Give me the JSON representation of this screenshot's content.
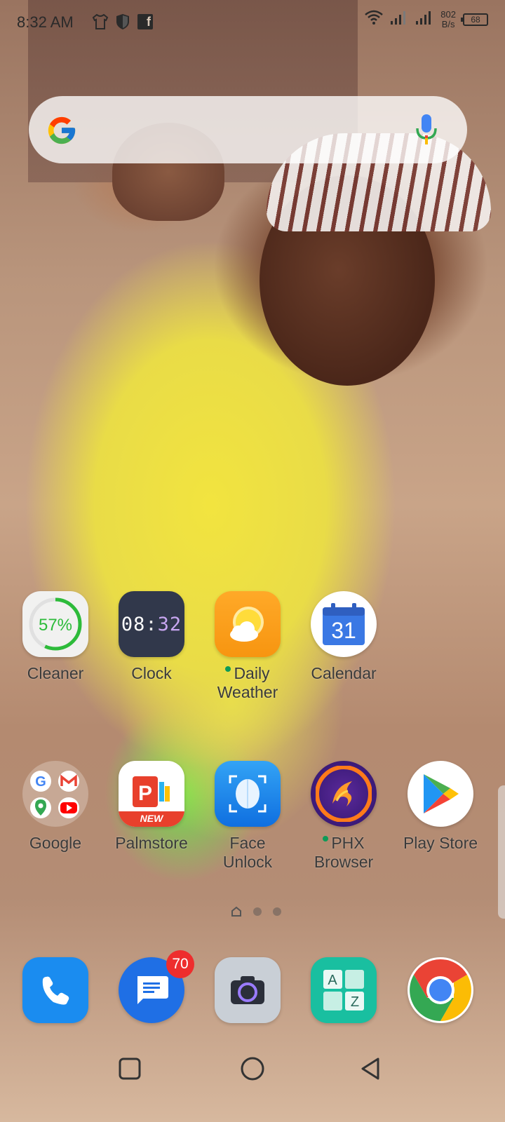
{
  "status_bar": {
    "time": "8:32 AM",
    "left_icons": [
      "shirt-icon",
      "shield-icon",
      "facebook-icon"
    ],
    "facebook_glyph": "f",
    "net_speed_value": "802",
    "net_speed_unit": "B/s",
    "battery_level": "68",
    "right_icons": [
      "wifi-icon",
      "signal-1-icon",
      "signal-2-icon",
      "battery-icon"
    ]
  },
  "search_bar": {
    "logo": "google-g-logo",
    "mic_icon": "mic-icon"
  },
  "apps_row1": [
    {
      "label": "Cleaner",
      "icon_text": "57%",
      "icon": "cleaner-icon"
    },
    {
      "label": "Clock",
      "icon_text_hours": "08",
      "icon_text_sep": ":",
      "icon_text_mins": "32",
      "icon": "clock-icon"
    },
    {
      "label_line1": "Daily",
      "label_line2": "Weather",
      "icon": "weather-icon",
      "new_dot": true
    },
    {
      "label": "Calendar",
      "icon_text": "31",
      "icon": "calendar-icon"
    }
  ],
  "apps_row2": [
    {
      "label": "Google",
      "icon": "google-folder-icon"
    },
    {
      "label": "Palmstore",
      "icon": "palmstore-icon",
      "badge_text": "NEW"
    },
    {
      "label_line1": "Face",
      "label_line2": "Unlock",
      "icon": "face-unlock-icon"
    },
    {
      "label_line1": "PHX",
      "label_line2": "Browser",
      "icon": "phx-browser-icon",
      "new_dot": true
    },
    {
      "label": "Play Store",
      "icon": "play-store-icon"
    }
  ],
  "dock": [
    {
      "name": "Phone",
      "icon": "phone-icon"
    },
    {
      "name": "Messages",
      "icon": "messages-icon",
      "badge": "70"
    },
    {
      "name": "Camera",
      "icon": "camera-icon"
    },
    {
      "name": "AZ",
      "icon": "az-icon",
      "letters": [
        "A",
        "Z"
      ]
    },
    {
      "name": "Chrome",
      "icon": "chrome-icon"
    }
  ],
  "page_indicator": {
    "pages": 3,
    "current": 0
  },
  "nav_bar": [
    "recents-button",
    "home-button",
    "back-button"
  ],
  "colors": {
    "text": "#3a3a3a",
    "badge": "#ee2d2d",
    "new_dot": "#0d9b58"
  }
}
